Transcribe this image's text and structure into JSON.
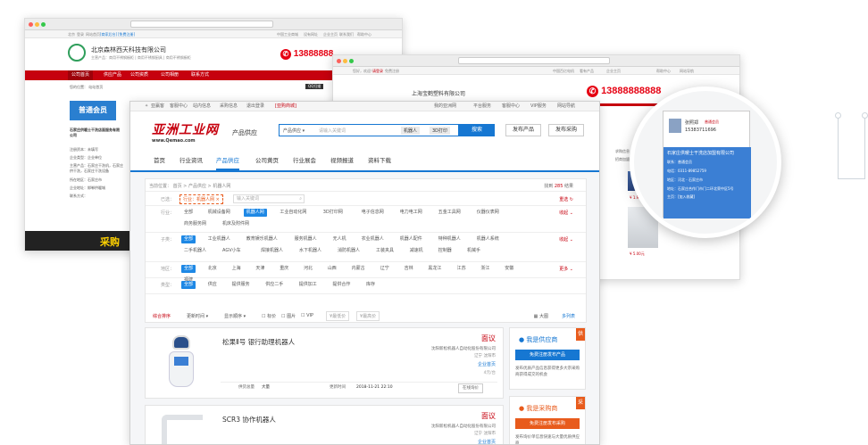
{
  "back_window": {
    "url": "",
    "top_links": [
      "北京",
      "登录",
      "网站首页",
      "[商家后台]",
      "[免费注册]",
      "中国工业商城",
      "设有网址",
      "企业主页",
      "联系我们",
      "帮助中心"
    ],
    "company_name": "北京森林西天科技有限公司",
    "company_sub": "主营产品：商用不锈钢橱柜 | 商用不锈钢厨具 | 商用不锈钢橱柜",
    "phone": "13888888",
    "nav": [
      "公司首页",
      "供应产品",
      "公司资质",
      "公司相册",
      "联系方式"
    ],
    "breadcrumb": "您的位置：  站站首页",
    "qr_label": "QQ扫描",
    "member_badge": "普通会员",
    "side_company": "石家庄供暖士干洗店面服务有限公司",
    "side_rows": [
      "注册资本：未填写",
      "企业类型：企业单位",
      "主营产品：石家庄干洗机，石家庄供干洗，石家庄干洗设备",
      "所在地区：石家庄市",
      "企业地址：邯郸供暖城",
      "联系方式："
    ],
    "side_more": [
      "查看全部",
      "查看全部"
    ],
    "bottom_text": "采购"
  },
  "mid_window": {
    "top_links": [
      "您好，欢迎！",
      "请登录",
      "免费注册",
      "中国百亿电机",
      "看有产品",
      "企业主页",
      "帮助中心",
      "网站导航"
    ],
    "company_name": "上海宝鹤塑料有限公司",
    "phone": "13888888888",
    "products": [
      {
        "price": "¥ 1.90元"
      },
      {
        "price": "¥ 5.00元"
      }
    ],
    "side_tags": [
      "求购信息",
      "招商加盟厂"
    ]
  },
  "main_window": {
    "top_links": [
      "亚赢客",
      "客服中心",
      "站内信息",
      "采购信息",
      "退出登录",
      "[亚购商城]"
    ],
    "top_right": [
      "我的亚洲网",
      "平台服务",
      "客服中心",
      "VIP服务",
      "网站导航"
    ],
    "logo_title": "亚洲工业网",
    "logo_url": "www.Qemao.com",
    "section_title": "产品供应",
    "search": {
      "category": "产品供应",
      "placeholder": "请输入关键词",
      "chips": [
        "机器人",
        "3D打印"
      ],
      "button": "搜索"
    },
    "header_buttons": [
      "发布产品",
      "发布采购"
    ],
    "tabs": [
      "首页",
      "行业资讯",
      "产品供应",
      "公司黄页",
      "行业展会",
      "视频报道",
      "资料下载"
    ],
    "active_tab": 2,
    "breadcrumb": "当前位置： 首页 > 产品供应 > 机器人网",
    "found_prefix": "找到",
    "found_count": "285",
    "found_suffix": "结果",
    "selected": {
      "label": "已选：",
      "chip": "行业：机器人网 ×",
      "input_placeholder": "输入关键词",
      "clear": "重选"
    },
    "filters": [
      {
        "label": "行业：",
        "items": [
          "全部",
          "机械设备网",
          "机器人网",
          "工业自动化网",
          "3D打印网",
          "电子信息网",
          "电力电工网",
          "五金工具网",
          "仪器仪表网",
          "商务服务网",
          "机床及附件网"
        ],
        "active": 2,
        "more": "收起"
      },
      {
        "label": "子类：",
        "items": [
          "全部",
          "工业机器人",
          "教育娱乐机器人",
          "服务机器人",
          "无人机",
          "农业机器人",
          "机器人配件",
          "特种机器人",
          "机器人系统",
          "二手机器人",
          "AGV小车",
          "焊接机器人",
          "水下机器人",
          "消防机器人",
          "工装夹具",
          "减速机",
          "控制器",
          "机械手"
        ],
        "active": 0,
        "more": "收起"
      },
      {
        "label": "地区：",
        "items": [
          "全部",
          "北京",
          "上海",
          "天津",
          "重庆",
          "河北",
          "山西",
          "内蒙古",
          "辽宁",
          "吉林",
          "黑龙江",
          "江苏",
          "浙江",
          "安徽",
          "福建"
        ],
        "active": 0,
        "more": "更多"
      },
      {
        "label": "类型：",
        "items": [
          "全部",
          "供应",
          "提供服务",
          "供应二手",
          "提供加工",
          "提供合作",
          "库存"
        ],
        "active": 0,
        "more": ""
      }
    ],
    "sortbar": {
      "items": [
        "综合排序",
        "更新时间",
        "显示顺序",
        "标价",
        "图片",
        "VIP"
      ],
      "min_price": "¥最低价",
      "max_price": "¥最高价",
      "view_big": "大图",
      "view_list": "多列表"
    },
    "products": [
      {
        "title": "松果Ⅱ号 银行助理机器人",
        "price": "面议",
        "company": "沈阳新松机器人自动化股份有限公司",
        "location": "辽宁 沈阳市",
        "badge": "企业首页",
        "views": "4元/台",
        "meta1": "供货总量",
        "meta1_val": "大量",
        "meta2": "更新时间",
        "meta2_val": "2018-11-21 22:10",
        "action": "在线询价"
      },
      {
        "title": "SCR3 协作机器人",
        "price": "面议",
        "company": "沈阳新松机器人自动化股份有限公司",
        "location": "辽宁 沈阳市",
        "badge": "企业首页"
      }
    ],
    "sidebar": {
      "supplier_title": "我是供应商",
      "supplier_tag": "供",
      "supplier_btn": "免费注册发布产品",
      "supplier_desc": "发布优质产品信息获得更多大宗采购商获得成交的机会",
      "buyer_title": "我是采购商",
      "buyer_tag": "采",
      "buyer_btn": "免费注册发布采购",
      "buyer_desc": "发布询价单信息快速与大量优质供应商"
    }
  },
  "zoom_card": {
    "name": "张照郑",
    "phone": "15383711696",
    "company": "石家庄供暖士干洗店加盟有限公司",
    "rows": [
      "联系：普通会员",
      "电话：0311-89852759",
      "地区：河北 - 石家庄市",
      "地址：石家庄合作门市门二环北荣中区5号",
      "主页：[加入收藏]"
    ],
    "title_bar": "普通会员"
  },
  "colors": {
    "brand_red": "#c6000e",
    "brand_blue": "#1677d2",
    "accent_orange": "#e85b1c",
    "zoom_blue": "#3b7fd4"
  }
}
